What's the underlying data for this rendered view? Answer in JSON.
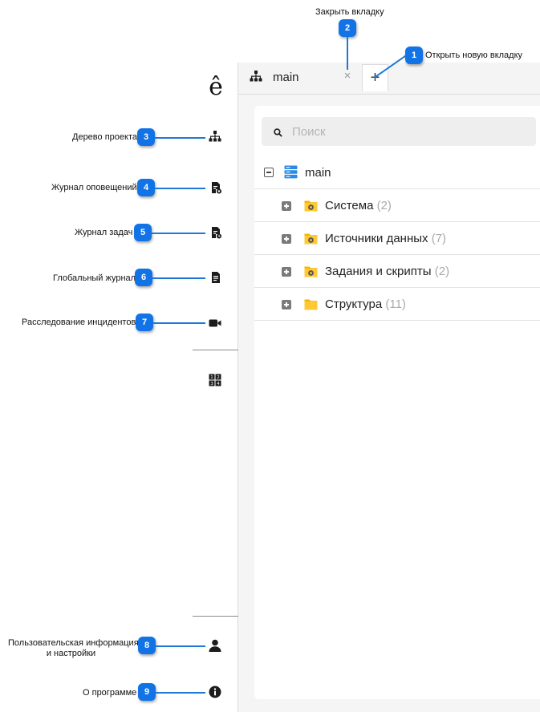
{
  "app": {
    "logo_glyph": "ê"
  },
  "tabs": [
    {
      "label": "main",
      "close_glyph": "×"
    }
  ],
  "new_tab_glyph": "+",
  "search": {
    "placeholder": "Поиск"
  },
  "tree": {
    "root": {
      "label": "main",
      "expanded": true
    },
    "children": [
      {
        "label": "Система",
        "count": "(2)",
        "icon": "folder-gear-icon"
      },
      {
        "label": "Источники данных",
        "count": "(7)",
        "icon": "folder-gear-icon"
      },
      {
        "label": "Задания и скрипты",
        "count": "(2)",
        "icon": "folder-gear-icon"
      },
      {
        "label": "Структура",
        "count": "(11)",
        "icon": "folder-icon"
      }
    ]
  },
  "sidebar_icons": [
    "project-tree-icon",
    "notification-log-icon",
    "task-log-icon",
    "global-log-icon",
    "video-camera-icon",
    "layout-grid-icon",
    "user-icon",
    "info-icon"
  ],
  "callouts": [
    {
      "number": "1",
      "text": "Открыть новую вкладку"
    },
    {
      "number": "2",
      "text": "Закрыть вкладку"
    },
    {
      "number": "3",
      "text": "Дерево проекта"
    },
    {
      "number": "4",
      "text": "Журнал оповещений"
    },
    {
      "number": "5",
      "text": "Журнал задач"
    },
    {
      "number": "6",
      "text": "Глобальный журнал"
    },
    {
      "number": "7",
      "text": "Расследование инцидентов"
    },
    {
      "number": "8",
      "text_line1": "Пользовательская информация",
      "text_line2": "и настройки"
    },
    {
      "number": "9",
      "text": "О программе"
    }
  ],
  "colors": {
    "accent": "#1273e6",
    "folder": "#f5b400",
    "db_icon": "#2a8ae6"
  }
}
